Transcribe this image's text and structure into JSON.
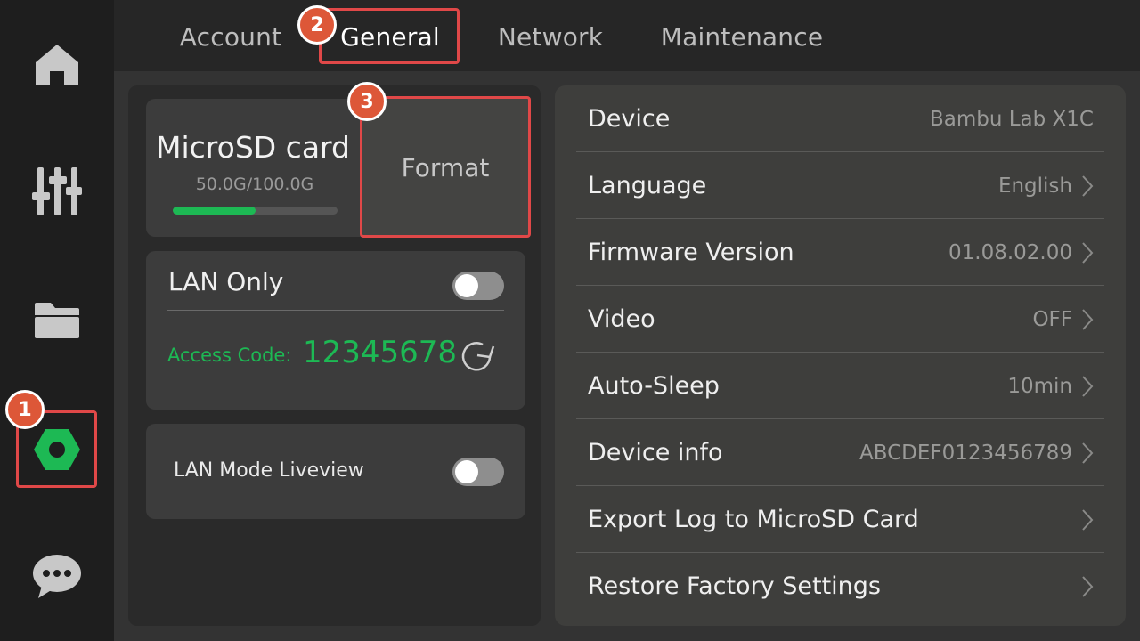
{
  "tabs": [
    {
      "label": "Account"
    },
    {
      "label": "General"
    },
    {
      "label": "Network"
    },
    {
      "label": "Maintenance"
    }
  ],
  "storage": {
    "title": "MicroSD card",
    "usage": "50.0G/100.0G",
    "used_fraction": 0.5,
    "format_label": "Format"
  },
  "lan": {
    "label": "LAN Only",
    "enabled": false,
    "access_code_label": "Access Code:",
    "access_code": "12345678"
  },
  "liveview": {
    "label": "LAN Mode Liveview",
    "enabled": false
  },
  "settings": [
    {
      "label": "Device",
      "value": "Bambu Lab X1C"
    },
    {
      "label": "Language",
      "value": "English"
    },
    {
      "label": "Firmware Version",
      "value": "01.08.02.00"
    },
    {
      "label": "Video",
      "value": "OFF"
    },
    {
      "label": "Auto-Sleep",
      "value": "10min"
    },
    {
      "label": "Device info",
      "value": "ABCDEF0123456789"
    },
    {
      "label": "Export Log to MicroSD Card",
      "value": ""
    },
    {
      "label": "Restore Factory Settings",
      "value": ""
    }
  ],
  "annotations": [
    "1",
    "2",
    "3"
  ],
  "sidebar": {
    "items": [
      {
        "icon": "home-icon"
      },
      {
        "icon": "sliders-icon"
      },
      {
        "icon": "folder-icon"
      },
      {
        "icon": "settings-hex-icon"
      },
      {
        "icon": "chat-icon"
      }
    ]
  },
  "colors": {
    "accent_green": "#1db954",
    "annotation_red": "#e04848",
    "badge_orange": "#dd5738"
  }
}
